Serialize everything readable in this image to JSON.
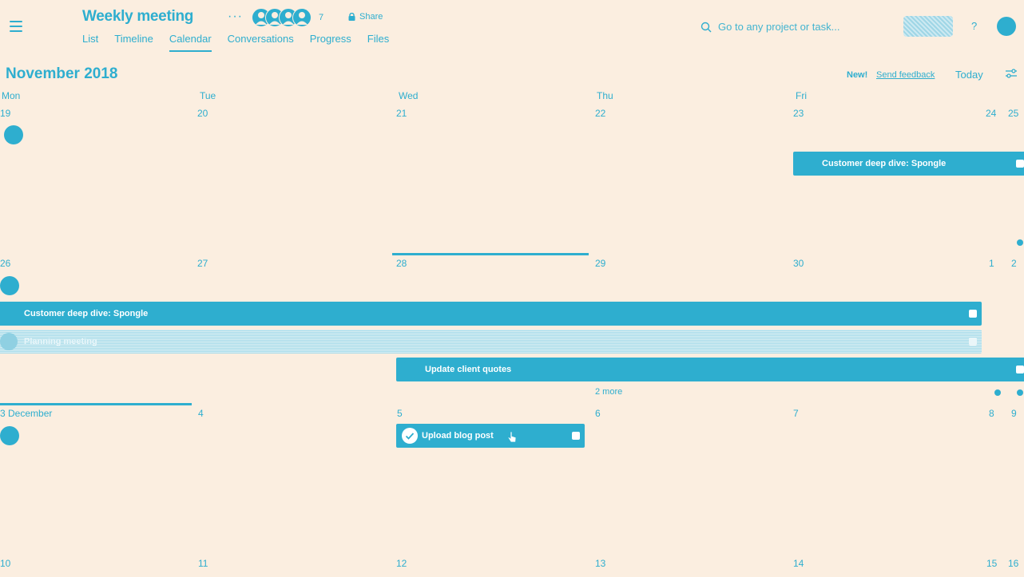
{
  "header": {
    "project_title": "Weekly meeting",
    "more_icon": "more-horizontal-icon",
    "member_count": "7",
    "share_label": "Share",
    "tabs": [
      "List",
      "Timeline",
      "Calendar",
      "Conversations",
      "Progress",
      "Files"
    ],
    "active_tab": "Calendar",
    "search_placeholder": "Go to any project or task...",
    "help_label": "?"
  },
  "toolbar": {
    "month_label": "November 2018",
    "new_badge": "New!",
    "feedback_label": "Send feedback",
    "today_label": "Today"
  },
  "calendar": {
    "weekdays": [
      "Mon",
      "Tue",
      "Wed",
      "Thu",
      "Fri"
    ],
    "weeks": [
      {
        "days": [
          "19",
          "20",
          "21",
          "22",
          "23"
        ],
        "weekend": [
          "24",
          "25"
        ]
      },
      {
        "days": [
          "26",
          "27",
          "28",
          "29",
          "30"
        ],
        "weekend": [
          "1",
          "2"
        ]
      },
      {
        "days": [
          "3 December",
          "4",
          "5",
          "6",
          "7"
        ],
        "weekend": [
          "8",
          "9"
        ]
      },
      {
        "days": [
          "10",
          "11",
          "12",
          "13",
          "14"
        ],
        "weekend": [
          "15",
          "16"
        ]
      }
    ],
    "events": {
      "e1": "Customer deep dive: Spongle",
      "e2": "Customer deep dive: Spongle",
      "e3": "Planning meeting",
      "e4": "Update client quotes",
      "e5": "Upload blog post"
    },
    "more_label": "2 more"
  },
  "colors": {
    "accent": "#2eaecf",
    "background": "#fbeee0"
  }
}
